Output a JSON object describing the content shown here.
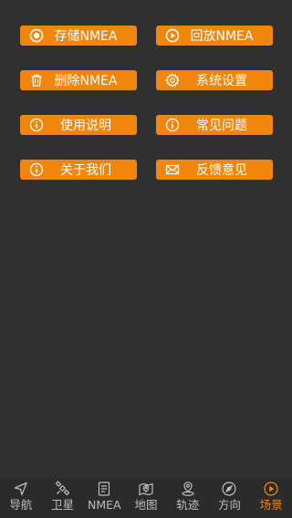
{
  "colors": {
    "background": "#303030",
    "button": "#f0860d",
    "tab_inactive": "#bdbdbd",
    "tab_active": "#f0860d"
  },
  "menu": {
    "save_nmea": {
      "label": "存储NMEA",
      "icon": "record-circle-icon"
    },
    "replay_nmea": {
      "label": "回放NMEA",
      "icon": "play-circle-icon"
    },
    "delete_nmea": {
      "label": "删除NMEA",
      "icon": "trash-icon"
    },
    "system_settings": {
      "label": "系统设置",
      "icon": "gear-icon"
    },
    "instructions": {
      "label": "使用说明",
      "icon": "info-circle-icon"
    },
    "faq": {
      "label": "常见问题",
      "icon": "info-circle-icon"
    },
    "about": {
      "label": "关于我们",
      "icon": "info-circle-icon"
    },
    "feedback": {
      "label": "反馈意见",
      "icon": "mail-icon"
    }
  },
  "tabs": [
    {
      "label": "导航",
      "icon": "navigation-arrow-icon",
      "active": false
    },
    {
      "label": "卫星",
      "icon": "satellite-icon",
      "active": false
    },
    {
      "label": "NMEA",
      "icon": "document-icon",
      "active": false
    },
    {
      "label": "地图",
      "icon": "map-pin-icon",
      "active": false
    },
    {
      "label": "轨迹",
      "icon": "location-pin-icon",
      "active": false
    },
    {
      "label": "方向",
      "icon": "compass-icon",
      "active": false
    },
    {
      "label": "场景",
      "icon": "play-circle-icon",
      "active": true
    }
  ]
}
